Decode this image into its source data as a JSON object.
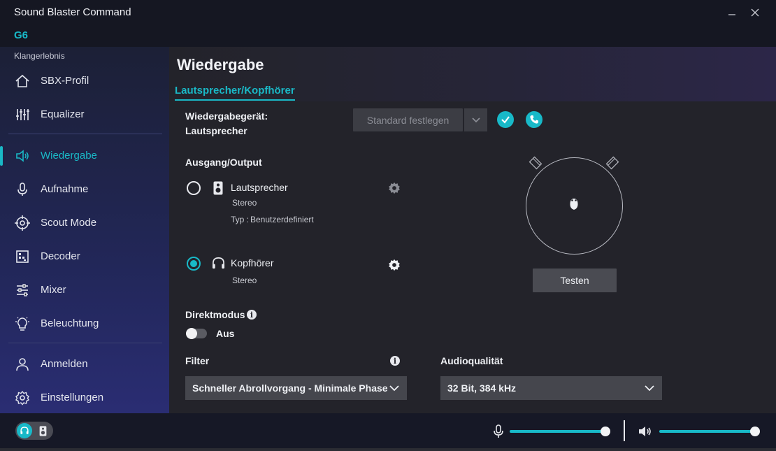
{
  "window": {
    "title": "Sound Blaster Command",
    "device": "G6"
  },
  "sidebar": {
    "section_label": "Klangerlebnis",
    "items": [
      {
        "label": "SBX-Profil",
        "icon": "home-icon"
      },
      {
        "label": "Equalizer",
        "icon": "equalizer-icon"
      },
      {
        "label": "Wiedergabe",
        "icon": "speaker-icon",
        "active": true
      },
      {
        "label": "Aufnahme",
        "icon": "microphone-icon"
      },
      {
        "label": "Scout Mode",
        "icon": "crosshair-icon"
      },
      {
        "label": "Decoder",
        "icon": "decoder-icon"
      },
      {
        "label": "Mixer",
        "icon": "mixer-icon"
      },
      {
        "label": "Beleuchtung",
        "icon": "bulb-icon"
      },
      {
        "label": "Anmelden",
        "icon": "user-icon"
      },
      {
        "label": "Einstellungen",
        "icon": "gear-icon"
      }
    ]
  },
  "main": {
    "title": "Wiedergabe",
    "tab": "Lautsprecher/Kopfhörer",
    "playback_device_label": "Wiedergabegerät:",
    "playback_device_value": "Lautsprecher",
    "set_default_button": "Standard festlegen",
    "output_section": "Ausgang/Output",
    "outputs": [
      {
        "name": "Lautsprecher",
        "mode": "Stereo",
        "type_label": "Typ :",
        "type_value": "Benutzerdefiniert",
        "selected": false
      },
      {
        "name": "Kopfhörer",
        "mode": "Stereo",
        "selected": true
      }
    ],
    "test_button": "Testen",
    "direct_mode": {
      "label": "Direktmodus",
      "state": "Aus"
    },
    "filter": {
      "label": "Filter",
      "value": "Schneller Abrollvorgang - Minimale Phase"
    },
    "audio_quality": {
      "label": "Audioqualität",
      "value": "32 Bit, 384 kHz"
    }
  },
  "bottom": {
    "mic_level": 1.0,
    "volume_level": 1.0
  },
  "colors": {
    "accent": "#18b9c8",
    "sidebar": "#222759",
    "main_bg": "#23232a"
  }
}
